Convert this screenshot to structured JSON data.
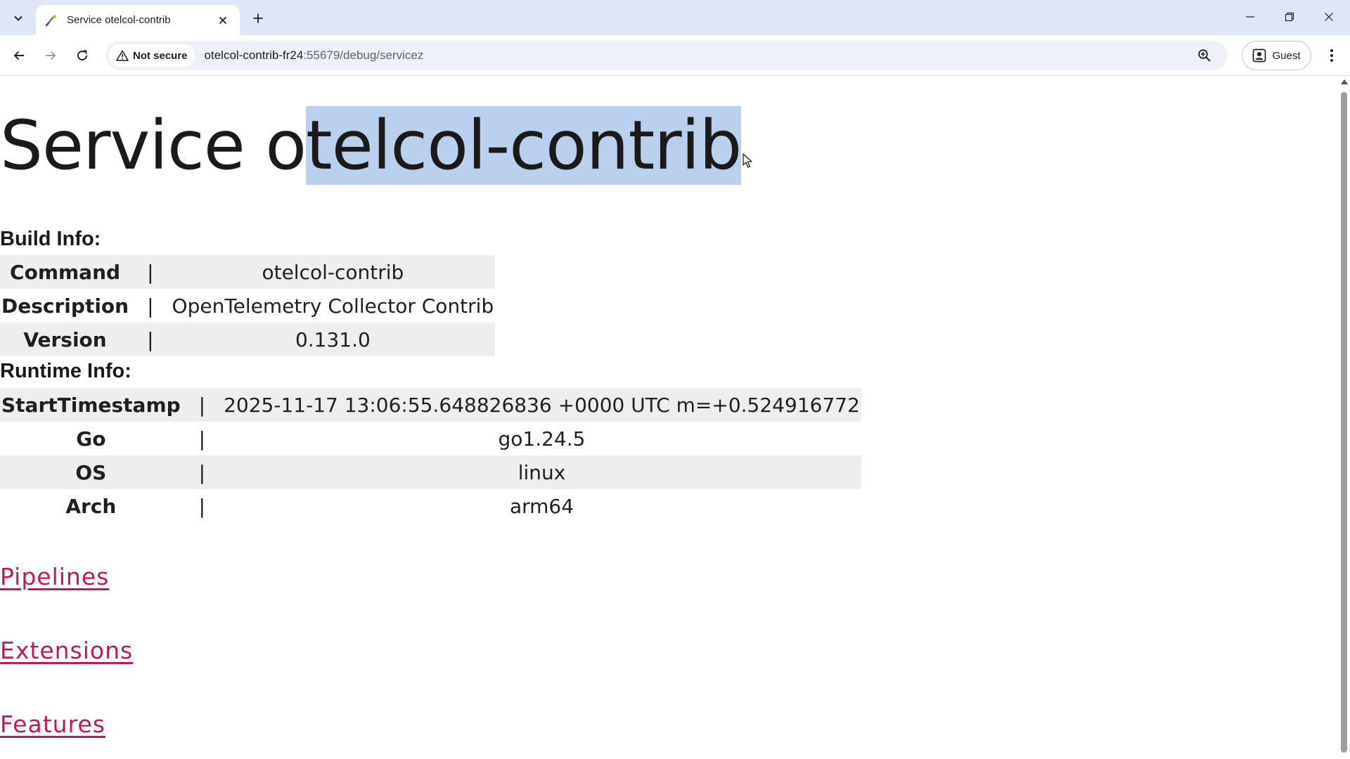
{
  "browser": {
    "tab": {
      "title": "Service otelcol-contrib"
    },
    "address": {
      "security_label": "Not secure",
      "url_host": "otelcol-contrib-fr24",
      "url_rest": ":55679/debug/servicez"
    },
    "profile_label": "Guest"
  },
  "page": {
    "title_prefix": "Service o",
    "title_selected": "telcol-contrib",
    "build_info": {
      "label": "Build Info:",
      "rows": [
        {
          "key": "Command",
          "sep": "|",
          "value": "otelcol-contrib"
        },
        {
          "key": "Description",
          "sep": "|",
          "value": "OpenTelemetry Collector Contrib"
        },
        {
          "key": "Version",
          "sep": "|",
          "value": "0.131.0"
        }
      ]
    },
    "runtime_info": {
      "label": "Runtime Info:",
      "rows": [
        {
          "key": "StartTimestamp",
          "sep": "|",
          "value": "2025-11-17 13:06:55.648826836 +0000 UTC m=+0.524916772"
        },
        {
          "key": "Go",
          "sep": "|",
          "value": "go1.24.5"
        },
        {
          "key": "OS",
          "sep": "|",
          "value": "linux"
        },
        {
          "key": "Arch",
          "sep": "|",
          "value": "arm64"
        }
      ]
    },
    "links": {
      "pipelines": "Pipelines",
      "extensions": "Extensions",
      "features": "Features"
    }
  },
  "colors": {
    "link": "#c2185b",
    "selection": "#b9d1ee",
    "tabstrip": "#dfe6f7"
  }
}
